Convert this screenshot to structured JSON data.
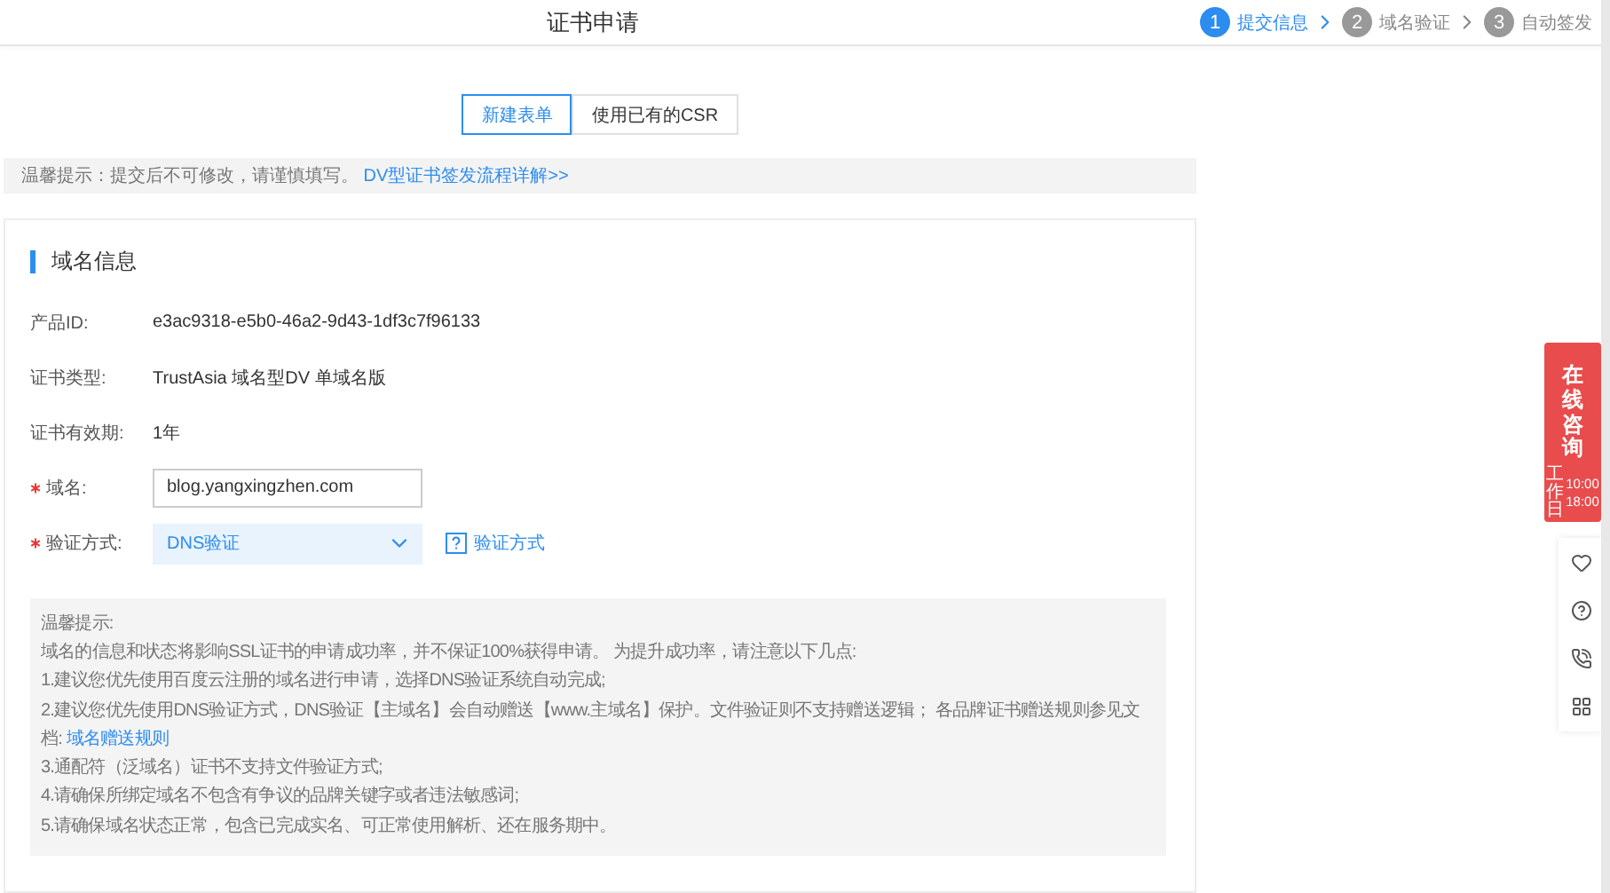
{
  "header": {
    "title": "证书申请",
    "steps": [
      {
        "number": "1",
        "label": "提交信息",
        "selected": true
      },
      {
        "number": "2",
        "label": "域名验证",
        "selected": false
      },
      {
        "number": "3",
        "label": "自动签发",
        "selected": false
      }
    ]
  },
  "mode_tabs": [
    {
      "label": "新建表单",
      "selected": true
    },
    {
      "label": "使用已有的CSR",
      "selected": false
    }
  ],
  "notice": {
    "text": "温馨提示：提交后不可修改，请谨慎填写。",
    "link": "DV型证书签发流程详解>>"
  },
  "section": {
    "title": "域名信息",
    "fields": [
      {
        "kind": "text",
        "label": "产品ID:",
        "required": false,
        "value": "e3ac9318-e5b0-46a2-9d43-1df3c7f96133"
      },
      {
        "kind": "text",
        "label": "证书类型:",
        "required": false,
        "value": "TrustAsia 域名型DV 单域名版"
      },
      {
        "kind": "text",
        "label": "证书有效期:",
        "required": false,
        "value": "1年"
      },
      {
        "kind": "input",
        "label": "域名:",
        "required": true,
        "value": "blog.yangxingzhen.com"
      },
      {
        "kind": "select",
        "label": "验证方式:",
        "required": true,
        "value": "DNS验证",
        "help": "验证方式"
      }
    ]
  },
  "tips": {
    "title": "温馨提示:",
    "lines": [
      {
        "text": "域名的信息和状态将影响SSL证书的申请成功率，并不保证100%获得申请。 为提升成功率，请注意以下几点:"
      },
      {
        "text": "1.建议您优先使用百度云注册的域名进行申请，选择DNS验证系统自动完成;"
      },
      {
        "text": "2.建议您优先使用DNS验证方式，DNS验证【主域名】会自动赠送【www.主域名】保护。文件验证则不支持赠送逻辑； 各品牌证书赠送规则参见文档:",
        "link": "域名赠送规则"
      },
      {
        "text": "3.通配符（泛域名）证书不支持文件验证方式;"
      },
      {
        "text": "4.请确保所绑定域名不包含有争议的品牌关键字或者违法敏感词;"
      },
      {
        "text": "5.请确保域名状态正常，包含已完成实名、可正常使用解析、还在服务期中。"
      }
    ]
  },
  "consult": {
    "title": "在线咨询",
    "days": "工作日",
    "start": "10:00",
    "end": "18:00"
  }
}
